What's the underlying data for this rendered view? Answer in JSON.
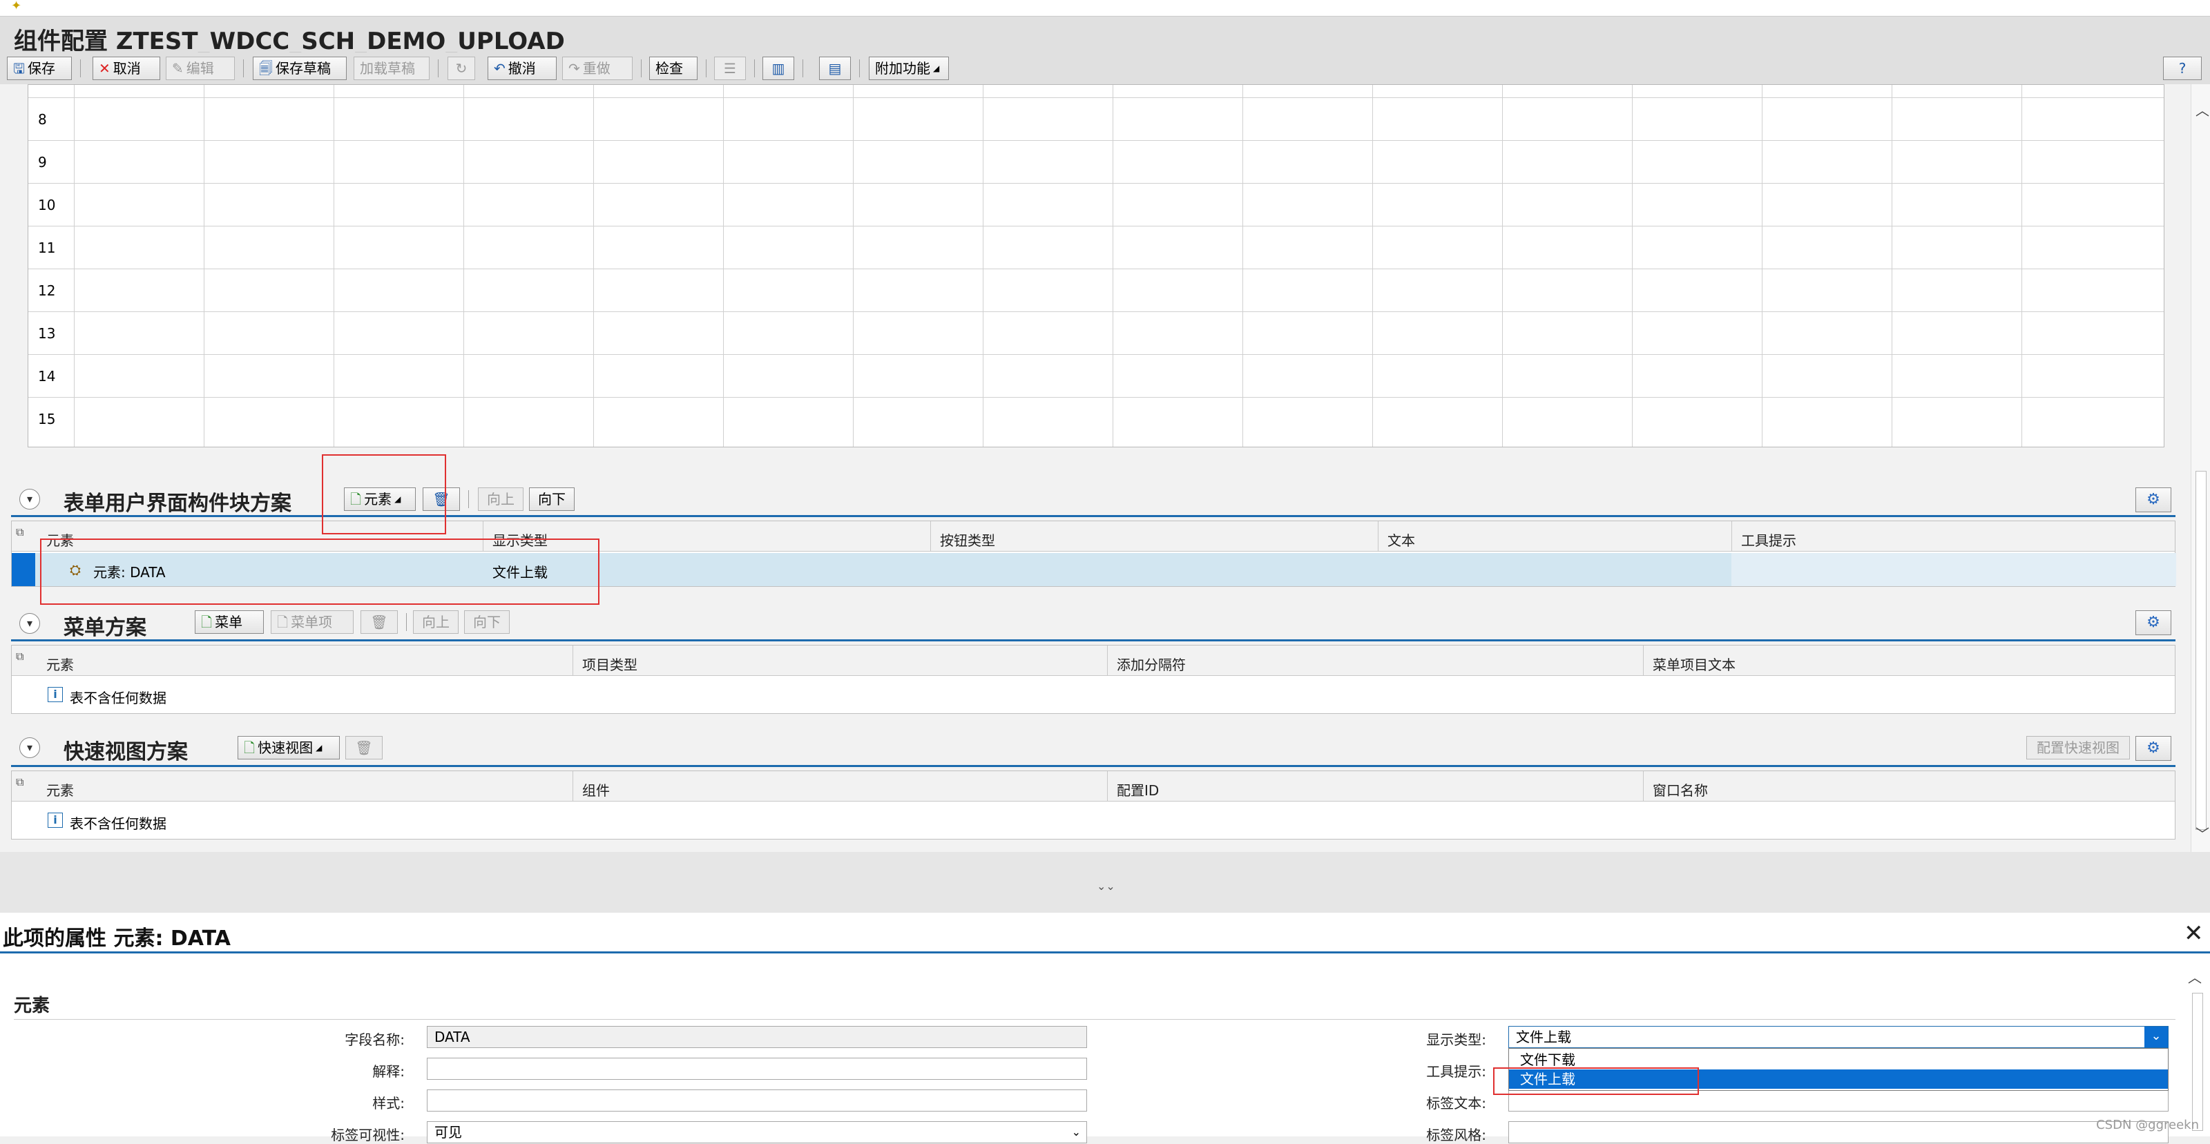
{
  "window": {
    "title": "组件配置 ZTEST_WDCC_SCH_DEMO_UPLOAD"
  },
  "toolbar": {
    "save": "保存",
    "cancel": "取消",
    "edit": "编辑",
    "save_draft": "保存草稿",
    "load_draft": "加载草稿",
    "undo": "撤消",
    "redo": "重做",
    "check": "检查",
    "extra": "附加功能"
  },
  "grid": {
    "row_numbers": [
      "8",
      "9",
      "10",
      "11",
      "12",
      "13",
      "14",
      "15"
    ]
  },
  "form_section": {
    "title": "表单用户界面构件块方案",
    "add_element": "元素",
    "move_up": "向上",
    "move_down": "向下",
    "columns": [
      "元素",
      "显示类型",
      "按钮类型",
      "文本",
      "工具提示"
    ],
    "rows": [
      {
        "element": "元素: DATA",
        "display_type": "文件上载",
        "button_type": "",
        "text": "",
        "tooltip": ""
      }
    ]
  },
  "menu_section": {
    "title": "菜单方案",
    "menu_btn": "菜单",
    "menu_item_btn": "菜单项",
    "move_up": "向上",
    "move_down": "向下",
    "columns": [
      "元素",
      "项目类型",
      "添加分隔符",
      "菜单项目文本"
    ],
    "empty": "表不含任何数据"
  },
  "quickview_section": {
    "title": "快速视图方案",
    "quickview_btn": "快速视图",
    "config_btn": "配置快速视图",
    "columns": [
      "元素",
      "组件",
      "配置ID",
      "窗口名称"
    ],
    "empty": "表不含任何数据"
  },
  "properties": {
    "title": "此项的属性 元素: DATA",
    "group": "元素",
    "field_name_label": "字段名称:",
    "field_name_value": "DATA",
    "explanation_label": "解释:",
    "explanation_value": "",
    "style_label": "样式:",
    "style_value": "",
    "label_visibility_label": "标签可视性:",
    "label_visibility_value": "可见",
    "display_type_label": "显示类型:",
    "display_type_value": "文件上载",
    "tooltip_label": "工具提示:",
    "label_text_label": "标签文本:",
    "label_style_label": "标签风格:",
    "display_type_options": [
      "文件下载",
      "文件上载"
    ],
    "selected_option": "文件上载"
  },
  "watermark": "CSDN @ggreekn",
  "colors": {
    "accent": "#1d6bae",
    "selection": "#0a6ed1",
    "highlight": "#e03030",
    "row_selected": "#d2e6f1"
  }
}
